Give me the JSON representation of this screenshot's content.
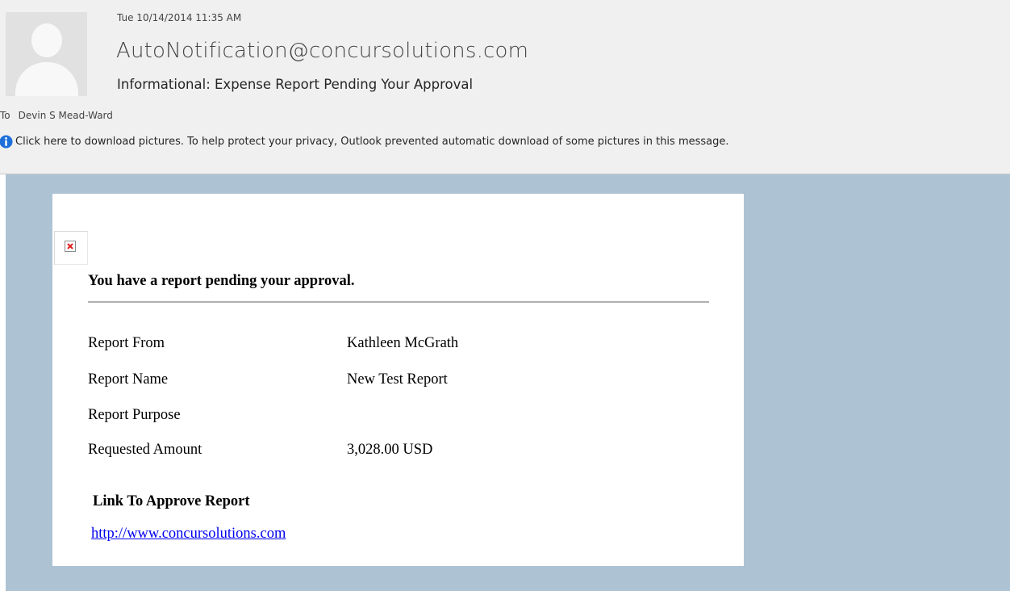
{
  "message": {
    "date": "Tue 10/14/2014 11:35 AM",
    "sender": "AutoNotification@concursolutions.com",
    "subject": "Informational: Expense Report Pending Your Approval",
    "to_label": "To",
    "to_recipient": "Devin S Mead-Ward",
    "info_bar_text": "Click here to download pictures. To help protect your privacy, Outlook prevented automatic download of some pictures in this message."
  },
  "body": {
    "title": "You have a report pending your approval.",
    "rows": [
      {
        "field": "Report From",
        "value": "Kathleen McGrath"
      },
      {
        "field": "Report Name",
        "value": "New Test Report"
      },
      {
        "field": "Report Purpose",
        "value": ""
      },
      {
        "field": "Requested Amount",
        "value": "3,028.00 USD"
      }
    ],
    "link_heading": "Link To Approve Report",
    "link_text": "http://www.concursolutions.com"
  },
  "icons": {
    "avatar": "person-silhouette-icon",
    "info": "info-icon",
    "broken_image": "broken-image-icon"
  },
  "colors": {
    "header_background": "#f0f0f0",
    "reading_pane_background": "#adc3d4",
    "card_background": "#ffffff",
    "info_icon": "#1e6fd9",
    "broken_image_x": "#e02020",
    "link": "#0000ee"
  }
}
